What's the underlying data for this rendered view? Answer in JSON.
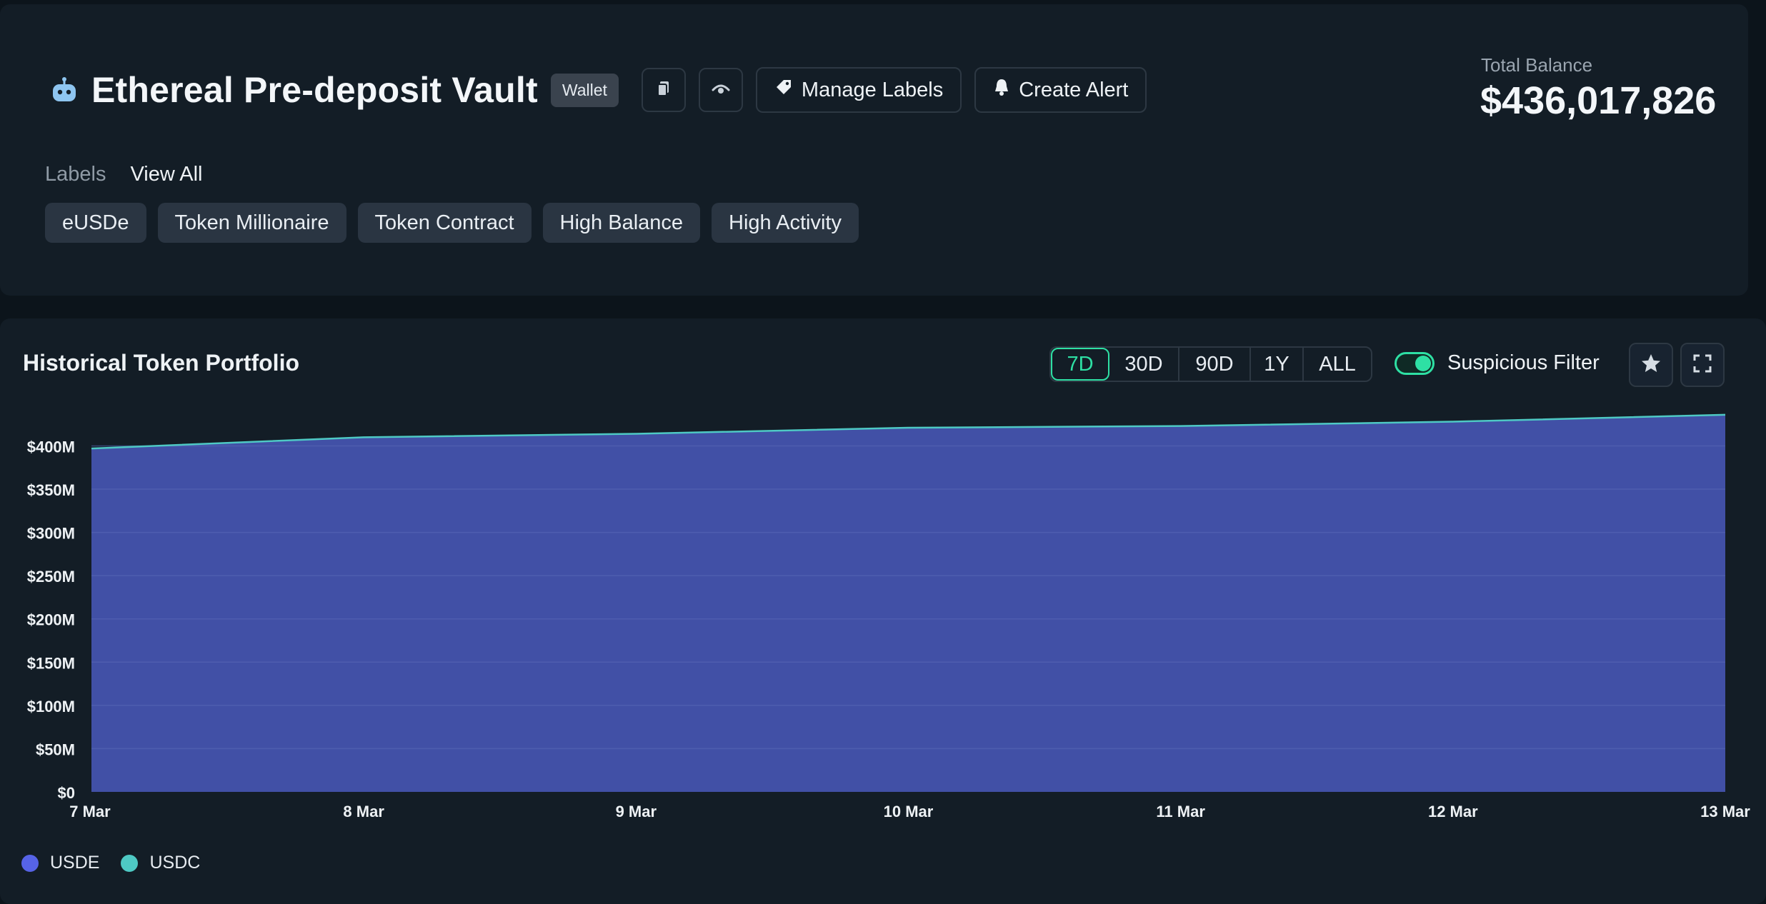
{
  "header": {
    "title": "Ethereal Pre-deposit Vault",
    "badge": "Wallet",
    "manage_labels": "Manage Labels",
    "create_alert": "Create Alert",
    "balance_label": "Total Balance",
    "balance_value": "$436,017,826"
  },
  "labels": {
    "heading": "Labels",
    "view_all": "View All",
    "tags": [
      "eUSDe",
      "Token Millionaire",
      "Token Contract",
      "High Balance",
      "High Activity"
    ]
  },
  "chart_panel": {
    "title": "Historical Token Portfolio",
    "ranges": [
      "7D",
      "30D",
      "90D",
      "1Y",
      "ALL"
    ],
    "active_range": "7D",
    "suspicious_filter": "Suspicious Filter",
    "suspicious_filter_on": true
  },
  "colors": {
    "accent": "#2ee0a4",
    "usde": "#5663e6",
    "usdc": "#4ec9c4",
    "area_fill": "#4150a6"
  },
  "chart_data": {
    "type": "area",
    "title": "Historical Token Portfolio",
    "xlabel": "",
    "ylabel": "",
    "x": [
      "7 Mar",
      "8 Mar",
      "9 Mar",
      "10 Mar",
      "11 Mar",
      "12 Mar",
      "13 Mar"
    ],
    "y_ticks": [
      "$0",
      "$50M",
      "$100M",
      "$150M",
      "$200M",
      "$250M",
      "$300M",
      "$350M",
      "$400M"
    ],
    "ylim": [
      0,
      440
    ],
    "y_unit": "$M",
    "grid": true,
    "legend_position": "bottom-left",
    "series": [
      {
        "name": "USDE",
        "values": [
          397,
          410,
          414,
          421,
          423,
          428,
          436
        ]
      },
      {
        "name": "USDC",
        "values": [
          0,
          0,
          0,
          0,
          0,
          0,
          0
        ]
      }
    ]
  }
}
